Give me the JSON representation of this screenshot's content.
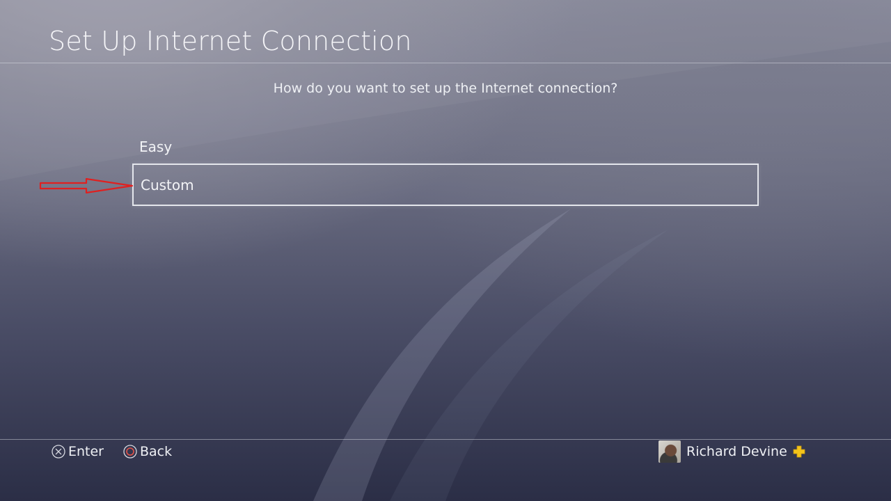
{
  "header": {
    "title": "Set Up Internet Connection"
  },
  "prompt": {
    "question": "How do you want to set up the Internet connection?"
  },
  "options": [
    {
      "label": "Easy",
      "selected": false
    },
    {
      "label": "Custom",
      "selected": true
    }
  ],
  "annotation": {
    "arrow_color": "#e02020"
  },
  "footer": {
    "enter_label": "Enter",
    "back_label": "Back",
    "enter_icon": "cross-button-icon",
    "back_icon": "circle-button-icon",
    "user_name": "Richard Devine",
    "plus_icon": "playstation-plus-icon",
    "plus_color": "#f3c31a"
  }
}
